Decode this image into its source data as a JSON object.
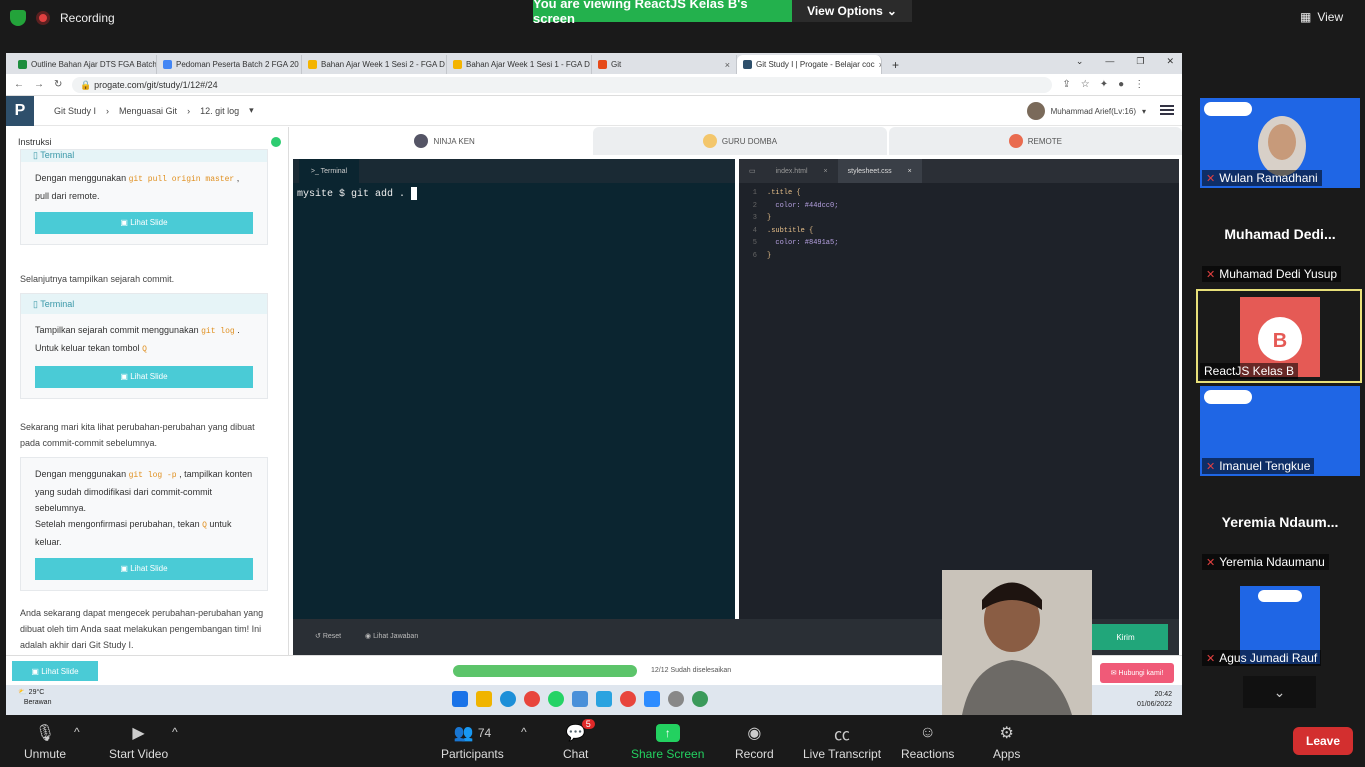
{
  "zoom": {
    "recording": "Recording",
    "banner": "You are viewing ReactJS Kelas B's screen",
    "view_options": "View Options",
    "view": "View",
    "toolbar": {
      "unmute": "Unmute",
      "start_video": "Start Video",
      "participants": "Participants",
      "participants_count": "74",
      "chat": "Chat",
      "chat_badge": "5",
      "share_screen": "Share Screen",
      "record": "Record",
      "live_transcript": "Live Transcript",
      "reactions": "Reactions",
      "apps": "Apps",
      "leave": "Leave"
    },
    "participants": [
      {
        "name": "Wulan Ramadhani"
      },
      {
        "name": "Muhamad Dedi Yusup",
        "big": "Muhamad  Dedi..."
      },
      {
        "name": "ReactJS Kelas B"
      },
      {
        "name": "Imanuel Tengkue"
      },
      {
        "name": "Yeremia Ndaumanu",
        "big": "Yeremia  Ndaum..."
      },
      {
        "name": "Agus Jumadi Rauf"
      }
    ]
  },
  "browser": {
    "tabs": [
      {
        "title": "Outline Bahan Ajar DTS FGA Batch",
        "color": "#1e8e3e"
      },
      {
        "title": "Pedoman Peserta Batch 2 FGA 20",
        "color": "#4285f4"
      },
      {
        "title": "Bahan Ajar Week 1 Sesi 2 - FGA D",
        "color": "#f4b400"
      },
      {
        "title": "Bahan Ajar Week 1 Sesi 1 - FGA D",
        "color": "#f4b400"
      },
      {
        "title": "Git",
        "color": "#e64a19"
      },
      {
        "title": "Git Study I | Progate - Belajar coc",
        "color": "#2e4f6b"
      }
    ],
    "url": "progate.com/git/study/1/12#/24"
  },
  "progate": {
    "breadcrumb": [
      "Git Study I",
      "Menguasai Git",
      "12. git log"
    ],
    "user": "Muhammad Arief(Lv:16)",
    "instruksi": "Instruksi",
    "card1": {
      "title": "Terminal",
      "text_a": "Dengan menggunakan ",
      "code": "git pull origin master",
      "text_b": " , pull dari remote."
    },
    "lihat_slide": "Lihat Slide",
    "para1": "Selanjutnya tampilkan sejarah commit.",
    "card2": {
      "title": "Terminal",
      "text_a": "Tampilkan sejarah commit menggunakan ",
      "code": "git log",
      "text_b": " . Untuk keluar tekan tombol ",
      "key": "Q"
    },
    "para2": "Sekarang mari kita lihat perubahan-perubahan yang dibuat pada commit-commit sebelumnya.",
    "card3": {
      "text_a": "Dengan menggunakan ",
      "code": "git log -p",
      "text_b": " , tampilkan konten yang sudah dimodifikasi dari commit-commit sebelumnya.",
      "text_c": "Setelah mengonfirmasi perubahan, tekan ",
      "key": "Q",
      "text_d": " untuk keluar."
    },
    "para3": "Anda sekarang dapat mengecek perubahan-perubahan yang dibuat oleh tim Anda saat melakukan pengembangan tim! Ini adalah akhir dari Git Study I.",
    "modes": [
      "NINJA KEN",
      "GURU DOMBA",
      "REMOTE"
    ],
    "terminal_tab": ">_ Terminal",
    "terminal_line": "mysite $ git add .",
    "editor_tabs": [
      "index.html",
      "stylesheet.css"
    ],
    "code_lines": [
      ".title {",
      "  color: #44dcc0;",
      "}",
      ".subtitle {",
      "  color: #8491a5;",
      "}"
    ],
    "reset": "Reset",
    "lihat_jawaban": "Lihat Jawaban",
    "kirim": "Kirim",
    "progress_text": "12/12 Sudah diselesaikan",
    "progress_fraction": 1.0,
    "hubungi": "Hubungi kami!"
  },
  "windows": {
    "temp": "29°C",
    "weather": "Berawan",
    "time": "20:42",
    "date": "01/06/2022"
  }
}
